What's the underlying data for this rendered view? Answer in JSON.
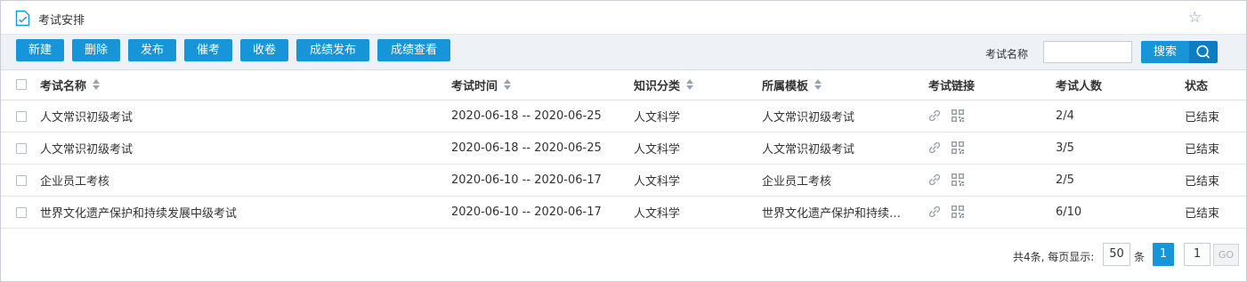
{
  "header": {
    "title": "考试安排"
  },
  "toolbar": {
    "buttons": [
      "新建",
      "删除",
      "发布",
      "催考",
      "收卷",
      "成绩发布",
      "成绩查看"
    ],
    "search_label": "考试名称",
    "search_value": "",
    "search_button": "搜索"
  },
  "table": {
    "columns": [
      "考试名称",
      "考试时间",
      "知识分类",
      "所属模板",
      "考试链接",
      "考试人数",
      "状态"
    ],
    "rows": [
      {
        "name": "人文常识初级考试",
        "time": "2020-06-18 -- 2020-06-25",
        "category": "人文科学",
        "template": "人文常识初级考试",
        "count": "2/4",
        "status": "已结束"
      },
      {
        "name": "人文常识初级考试",
        "time": "2020-06-18 -- 2020-06-25",
        "category": "人文科学",
        "template": "人文常识初级考试",
        "count": "3/5",
        "status": "已结束"
      },
      {
        "name": "企业员工考核",
        "time": "2020-06-10 -- 2020-06-17",
        "category": "人文科学",
        "template": "企业员工考核",
        "count": "2/5",
        "status": "已结束"
      },
      {
        "name": "世界文化遗产保护和持续发展中级考试",
        "time": "2020-06-10 -- 2020-06-17",
        "category": "人文科学",
        "template": "世界文化遗产保护和持续…",
        "count": "6/10",
        "status": "已结束"
      }
    ]
  },
  "pager": {
    "summary": "共4条, 每页显示:",
    "page_size": "50",
    "page_size_unit": "条",
    "current_page": "1",
    "goto_value": "1",
    "go_label": "GO"
  },
  "colors": {
    "accent": "#1696d9",
    "accent_dark": "#0d7cc0",
    "toolbar_bg": "#eef2f7"
  }
}
